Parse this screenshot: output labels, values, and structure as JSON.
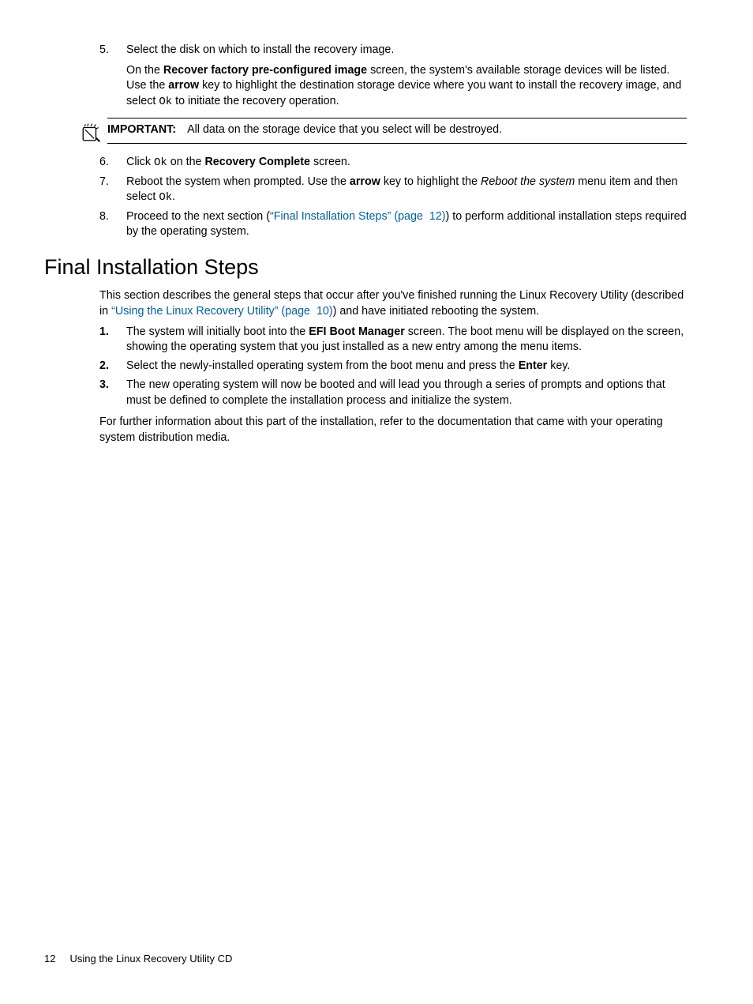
{
  "stepsA": {
    "n5": "5.",
    "s5a": "Select the disk on which to install the recovery image.",
    "s5b_1": "On the ",
    "s5b_bold1": "Recover factory pre-configured image",
    "s5b_2": " screen, the system's available storage devices will be listed. Use the ",
    "s5b_bold2": "arrow",
    "s5b_3": " key to highlight the destination storage device where you want to install the recovery image, and select ",
    "s5b_mono": "Ok",
    "s5b_4": " to initiate the recovery operation."
  },
  "important": {
    "label": "IMPORTANT:",
    "text": "All data on the storage device that you select will be destroyed."
  },
  "stepsB": {
    "n6": "6.",
    "s6_1": "Click ",
    "s6_mono": "Ok",
    "s6_2": " on the ",
    "s6_bold": "Recovery Complete",
    "s6_3": " screen.",
    "n7": "7.",
    "s7_1": "Reboot the system when prompted. Use the ",
    "s7_bold": "arrow",
    "s7_2": " key to highlight the ",
    "s7_italic": "Reboot the system",
    "s7_3": " menu item and then select ",
    "s7_mono": "Ok",
    "s7_4": ".",
    "n8": "8.",
    "s8_1": "Proceed to the next section (",
    "s8_link": "“Final Installation Steps” (page  12)",
    "s8_2": ") to perform additional installation steps required by the operating system."
  },
  "heading": "Final Installation Steps",
  "intro": {
    "p1_1": "This section describes the general steps that occur after you've finished running the Linux Recovery Utility (described in ",
    "p1_link": "“Using the Linux Recovery Utility” (page  10)",
    "p1_2": ") and have initiated rebooting the system."
  },
  "stepsC": {
    "n1": "1.",
    "s1_1": "The system will initially boot into the ",
    "s1_bold": "EFI Boot Manager",
    "s1_2": " screen. The boot menu will be displayed on the screen, showing the operating system that you just installed as a new entry among the menu items.",
    "n2": "2.",
    "s2_1": "Select the newly-installed operating system from the boot menu and press the ",
    "s2_bold": "Enter",
    "s2_2": " key.",
    "n3": "3.",
    "s3": "The new operating system will now be booted and will lead you through a series of prompts and options that must be defined to complete the installation process and initialize the system."
  },
  "closing": "For further information about this part of the installation, refer to the documentation that came with your operating system distribution media.",
  "footer": {
    "page": "12",
    "title": "Using the Linux Recovery Utility CD"
  }
}
